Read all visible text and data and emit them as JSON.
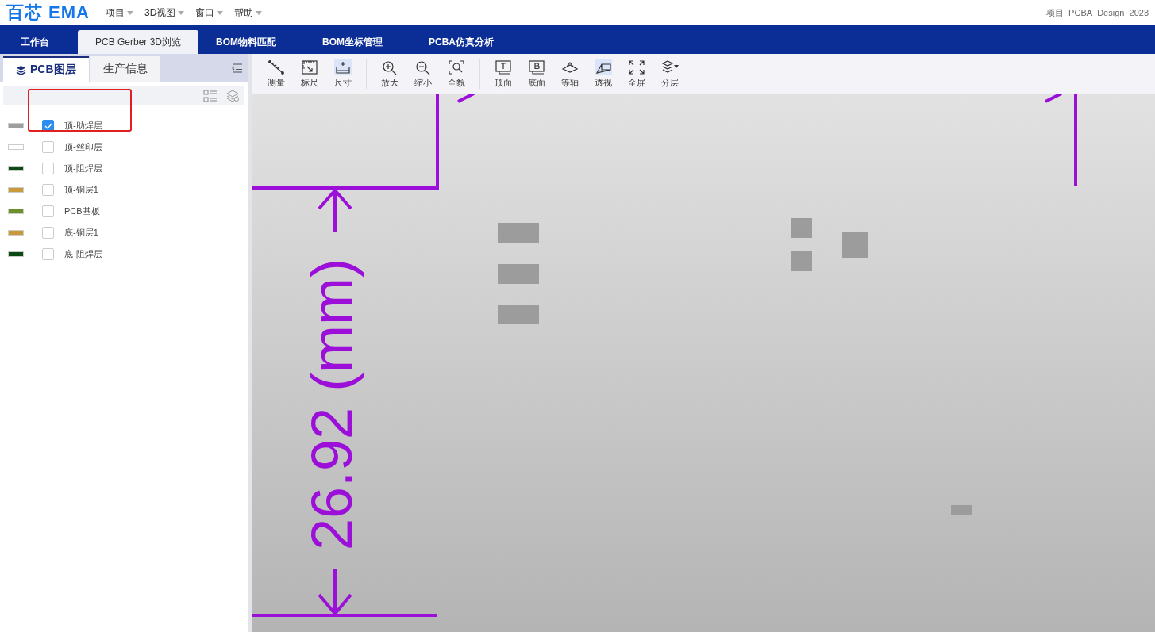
{
  "app": {
    "logo": "百芯 EMA",
    "project": "项目: PCBA_Design_2023"
  },
  "menu": [
    {
      "label": "项目"
    },
    {
      "label": "3D视图"
    },
    {
      "label": "窗口"
    },
    {
      "label": "帮助"
    }
  ],
  "nav_tabs": [
    {
      "label": "工作台",
      "selected": false
    },
    {
      "label": "PCB Gerber 3D浏览",
      "selected": true
    },
    {
      "label": "BOM物料匹配",
      "selected": false
    },
    {
      "label": "BOM坐标管理",
      "selected": false
    },
    {
      "label": "PCBA仿真分析",
      "selected": false
    }
  ],
  "panel_tabs": [
    {
      "label": "PCB图层",
      "selected": true
    },
    {
      "label": "生产信息",
      "selected": false
    }
  ],
  "layers": [
    {
      "label": "顶-助焊层",
      "color": "#9e9e9e",
      "checked": true,
      "highlighted": true
    },
    {
      "label": "顶-丝印层",
      "color": "#ffffff",
      "checked": false,
      "highlighted": false
    },
    {
      "label": "顶-阻焊层",
      "color": "#0a4a12",
      "checked": false,
      "highlighted": false
    },
    {
      "label": "顶-铜层1",
      "color": "#c99a3c",
      "checked": false,
      "highlighted": false
    },
    {
      "label": "PCB基板",
      "color": "#6f8f2a",
      "checked": false,
      "highlighted": false
    },
    {
      "label": "底-铜层1",
      "color": "#c99a3c",
      "checked": false,
      "highlighted": false
    },
    {
      "label": "底-阻焊层",
      "color": "#0a4a12",
      "checked": false,
      "highlighted": false
    }
  ],
  "toolbar": [
    [
      {
        "label": "测量",
        "kind": "measure",
        "selected": false
      },
      {
        "label": "标尺",
        "kind": "ruler",
        "selected": false
      },
      {
        "label": "尺寸",
        "kind": "dimension",
        "selected": true
      }
    ],
    [
      {
        "label": "放大",
        "kind": "zoom-in",
        "selected": false
      },
      {
        "label": "缩小",
        "kind": "zoom-out",
        "selected": false
      },
      {
        "label": "全貌",
        "kind": "fit",
        "selected": false
      }
    ],
    [
      {
        "label": "顶面",
        "kind": "top",
        "selected": false
      },
      {
        "label": "底面",
        "kind": "bottom",
        "selected": false
      },
      {
        "label": "等轴",
        "kind": "iso",
        "selected": false
      },
      {
        "label": "透视",
        "kind": "perspective",
        "selected": true
      },
      {
        "label": "全屏",
        "kind": "fullscreen",
        "selected": false
      },
      {
        "label": "分层",
        "kind": "layers",
        "selected": false
      }
    ]
  ],
  "viewport": {
    "height_dimension": "26.92 (mm)"
  }
}
